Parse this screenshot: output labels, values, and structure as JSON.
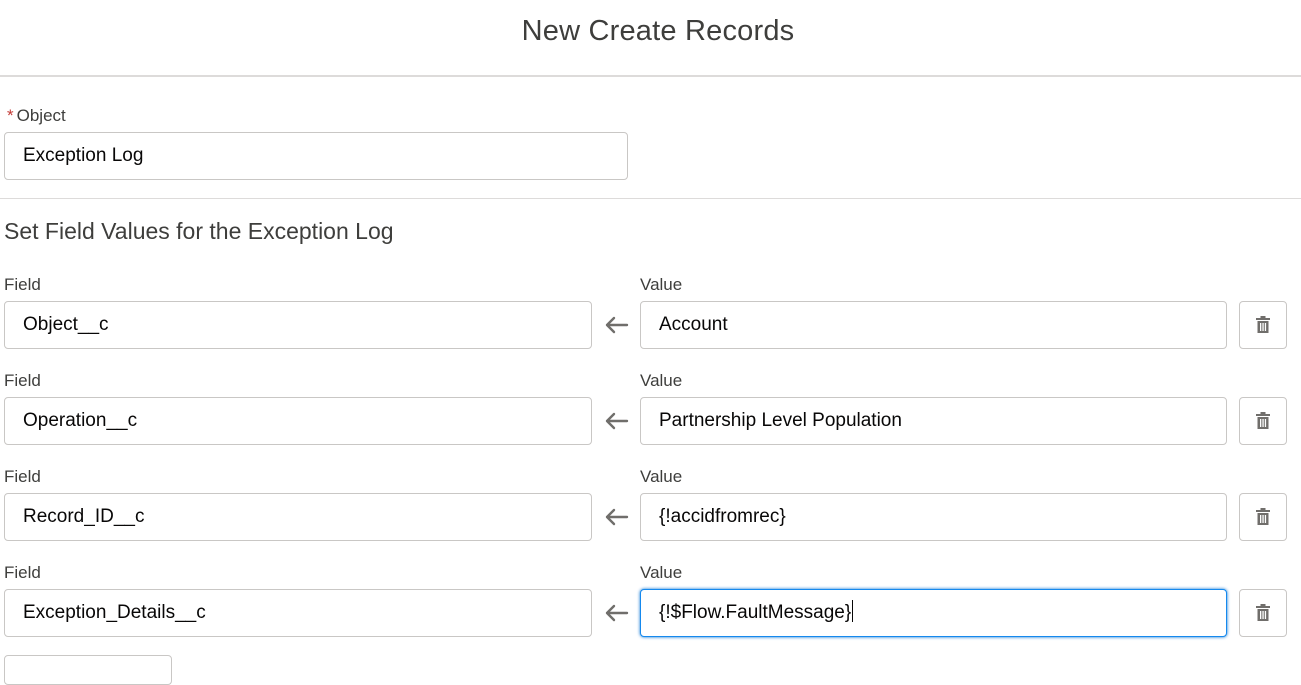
{
  "header": {
    "title": "New Create Records"
  },
  "object_field": {
    "required_marker": "*",
    "label": "Object",
    "value": "Exception Log"
  },
  "section": {
    "title": "Set Field Values for the Exception Log"
  },
  "rows": [
    {
      "field_label": "Field",
      "field_value": "Object__c",
      "value_label": "Value",
      "value_value": "Account"
    },
    {
      "field_label": "Field",
      "field_value": "Operation__c",
      "value_label": "Value",
      "value_value": "Partnership Level Population"
    },
    {
      "field_label": "Field",
      "field_value": "Record_ID__c",
      "value_label": "Value",
      "value_value": "{!accidfromrec}"
    },
    {
      "field_label": "Field",
      "field_value": "Exception_Details__c",
      "value_label": "Value",
      "value_value": "{!$Flow.FaultMessage}"
    }
  ],
  "icons": {
    "assignment_arrow": "arrow-left-icon",
    "delete": "trash-icon"
  },
  "colors": {
    "required": "#c23934",
    "focus_border": "#1589ee",
    "border": "#c9c7c5",
    "divider": "#dddbda"
  }
}
